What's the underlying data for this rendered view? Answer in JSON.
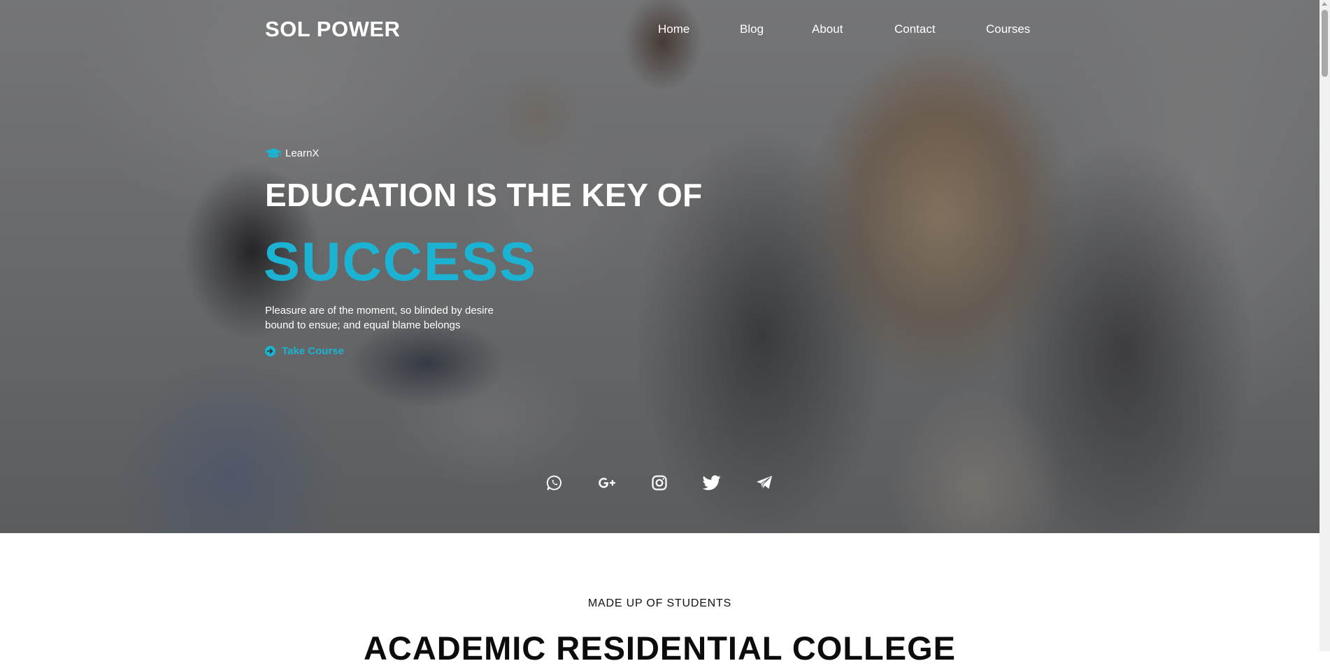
{
  "brand": {
    "name": "SOL POWER"
  },
  "nav": {
    "items": [
      {
        "label": "Home"
      },
      {
        "label": "Blog"
      },
      {
        "label": "About"
      },
      {
        "label": "Contact"
      },
      {
        "label": "Courses"
      }
    ]
  },
  "hero": {
    "tagline": "LearnX",
    "tagline_icon": "graduation-cap-icon",
    "headline": "EDUCATION IS THE KEY OF",
    "headline_accent": "SUCCESS",
    "description": "Pleasure are of the moment, so blinded by desire bound to ensue; and equal blame belongs",
    "cta_label": "Take Course",
    "cta_icon": "arrow-circle-right-icon",
    "accent_color": "#1bb3d1"
  },
  "social": {
    "icons": [
      "whatsapp-icon",
      "google-plus-icon",
      "instagram-icon",
      "twitter-icon",
      "telegram-icon"
    ]
  },
  "section": {
    "kicker": "MADE UP OF STUDENTS",
    "title": "ACADEMIC RESIDENTIAL COLLEGE"
  }
}
